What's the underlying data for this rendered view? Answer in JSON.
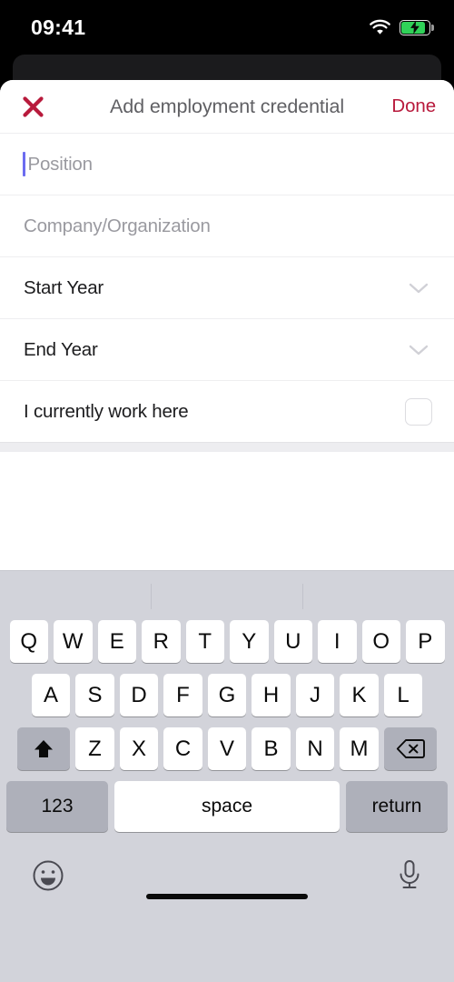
{
  "status_bar": {
    "time": "09:41",
    "wifi_icon": "wifi-icon",
    "battery_icon": "battery-charging-icon"
  },
  "sheet": {
    "close_icon": "close-x-icon",
    "title": "Add employment credential",
    "done_label": "Done"
  },
  "form": {
    "rows": [
      {
        "label": "Position",
        "type": "text-input",
        "is_placeholder": true,
        "focused": true,
        "accessory": "caret"
      },
      {
        "label": "Company/Organization",
        "type": "text-input",
        "is_placeholder": true,
        "focused": false,
        "accessory": "none"
      },
      {
        "label": "Start Year",
        "type": "select",
        "is_placeholder": false,
        "focused": false,
        "accessory": "chevron-down-icon"
      },
      {
        "label": "End Year",
        "type": "select",
        "is_placeholder": false,
        "focused": false,
        "accessory": "chevron-down-icon"
      },
      {
        "label": "I currently work here",
        "type": "checkbox",
        "is_placeholder": false,
        "focused": false,
        "accessory": "checkbox-unchecked"
      }
    ]
  },
  "keyboard": {
    "predictive_suggestions": [],
    "row1": [
      "Q",
      "W",
      "E",
      "R",
      "T",
      "Y",
      "U",
      "I",
      "O",
      "P"
    ],
    "row2": [
      "A",
      "S",
      "D",
      "F",
      "G",
      "H",
      "J",
      "K",
      "L"
    ],
    "row3_letters": [
      "Z",
      "X",
      "C",
      "V",
      "B",
      "N",
      "M"
    ],
    "shift_icon": "shift-up-arrow-icon",
    "backspace_icon": "backspace-delete-icon",
    "numeric_label": "123",
    "space_label": "space",
    "return_label": "return",
    "emoji_icon": "emoji-smiley-icon",
    "dictation_icon": "microphone-icon"
  },
  "colors": {
    "accent_red": "#b81a3c",
    "caret_blue": "#6c6cf0",
    "battery_green": "#30d158",
    "keyboard_bg": "#d2d3da",
    "key_fn_gray": "#aeb0ba"
  }
}
